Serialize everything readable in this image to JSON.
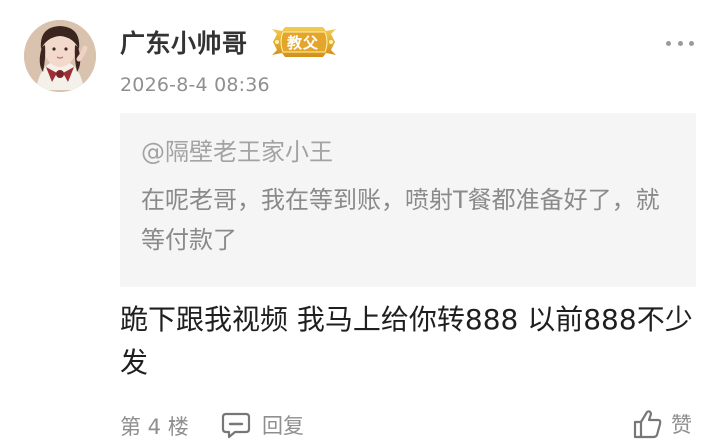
{
  "comment": {
    "author": {
      "name": "广东小帅哥",
      "badge": "教父",
      "avatar": "profile-photo"
    },
    "timestamp": "2026-8-4 08:36",
    "quoted": {
      "user": "@隔壁老王家小王",
      "text": "在呢老哥，我在等到账，喷射T餐都准备好了，就等付款了"
    },
    "text": "跪下跟我视频 我马上给你转888  以前888不少发",
    "floor": "第 4 楼",
    "reply_label": "回复",
    "like_label": "赞"
  },
  "icons": {
    "more": "more-dots-icon",
    "reply": "comment-bubble-icon",
    "like": "thumbs-up-icon"
  },
  "colors": {
    "badge": "#e2a72a",
    "muted": "#8f8f8f",
    "quote_background": "#f5f5f5"
  }
}
